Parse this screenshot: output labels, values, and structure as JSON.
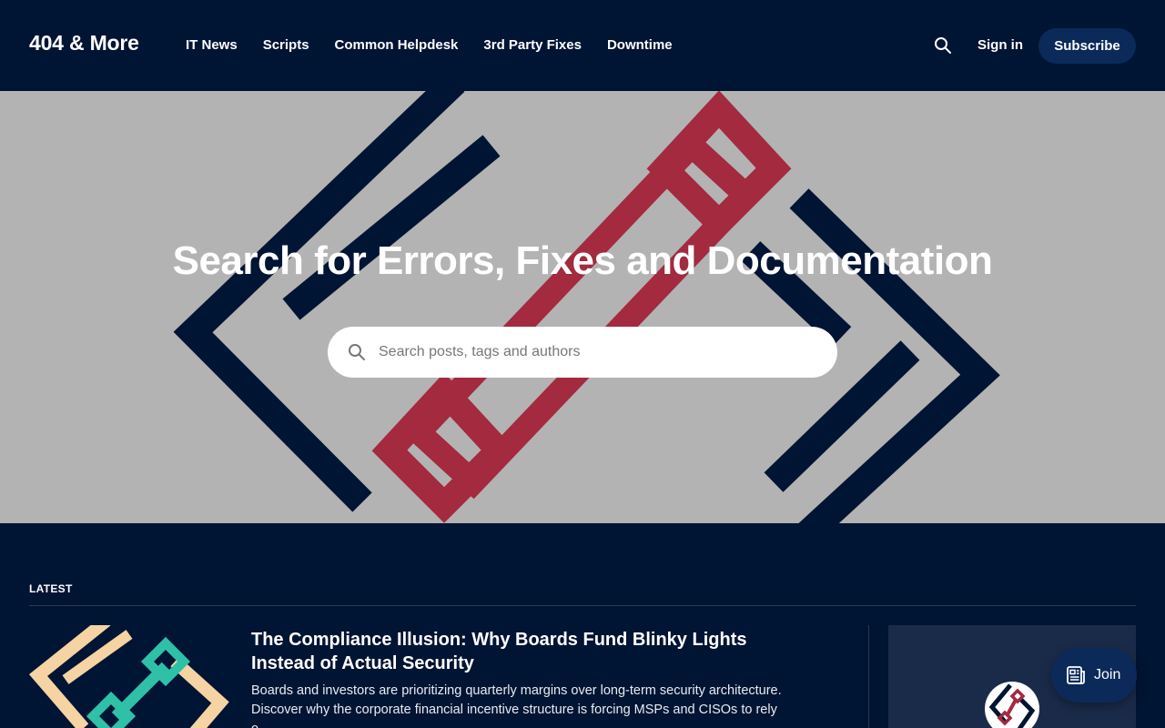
{
  "header": {
    "logo": "404 & More",
    "nav": [
      "IT News",
      "Scripts",
      "Common Helpdesk",
      "3rd Party Fixes",
      "Downtime"
    ],
    "signin": "Sign in",
    "subscribe": "Subscribe"
  },
  "hero": {
    "title": "Search for Errors, Fixes and Documentation",
    "search_placeholder": "Search posts, tags and authors"
  },
  "latest": {
    "label": "LATEST",
    "post": {
      "title": "The Compliance Illusion: Why Boards Fund Blinky Lights Instead of Actual Security",
      "excerpt": "Boards and investors are prioritizing quarterly margins over long-term security architecture. Discover why the corporate financial incentive structure is forcing MSPs and CISOs to rely o..."
    }
  },
  "join": {
    "label": "Join"
  },
  "colors": {
    "navy": "#001433",
    "crimson": "#a32a3f",
    "hero_bg": "#b3b3b3",
    "button_bg": "#0b2a5a",
    "thumb_beige": "#f5d3a3",
    "thumb_teal": "#2fc1a8"
  },
  "icons": [
    "search-icon",
    "newspaper-icon"
  ]
}
